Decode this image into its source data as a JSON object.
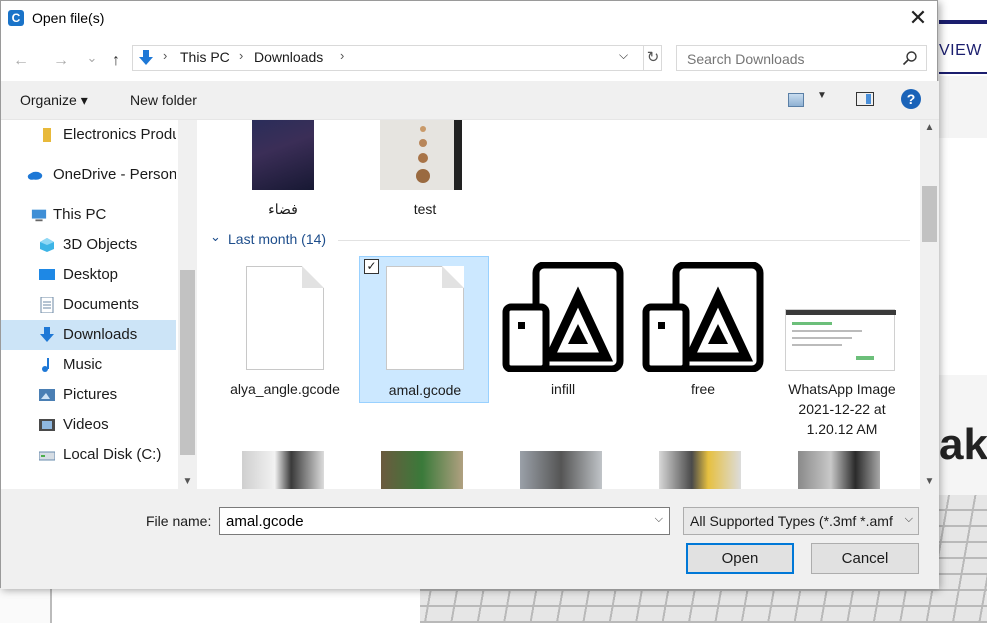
{
  "background_app": {
    "view_label": "VIEW",
    "big_text": "ake"
  },
  "dialog": {
    "title": "Open file(s)",
    "close_glyph": "✕"
  },
  "nav": {
    "back": "←",
    "forward": "→",
    "recent": "⌄",
    "up": "↑",
    "breadcrumbs": [
      "This PC",
      "Downloads"
    ],
    "sep": "›",
    "addr_dropdown": "⌵",
    "refresh": "↻",
    "search_placeholder": "Search Downloads"
  },
  "toolbar": {
    "organize": "Organize ▾",
    "new_folder": "New folder",
    "view_dropdown": "▼",
    "help": "?"
  },
  "sidebar": {
    "items": [
      {
        "label": "Electronics Produ",
        "icon": "folder-icon",
        "color": "#e8b93a"
      },
      {
        "label": "OneDrive - Persona",
        "icon": "onedrive-icon",
        "color": "#1e78d6"
      },
      {
        "label": "This PC",
        "icon": "this-pc-icon",
        "color": "#3f8fd6"
      },
      {
        "label": "3D Objects",
        "icon": "3d-objects-icon",
        "color": "#3cb4e6"
      },
      {
        "label": "Desktop",
        "icon": "desktop-icon",
        "color": "#1e88e5"
      },
      {
        "label": "Documents",
        "icon": "documents-icon",
        "color": "#6d8aa6"
      },
      {
        "label": "Downloads",
        "icon": "downloads-icon",
        "color": "#1e78d6"
      },
      {
        "label": "Music",
        "icon": "music-icon",
        "color": "#1e78d6"
      },
      {
        "label": "Pictures",
        "icon": "pictures-icon",
        "color": "#4a7fb4"
      },
      {
        "label": "Videos",
        "icon": "videos-icon",
        "color": "#4a4a4a"
      },
      {
        "label": "Local Disk (C:)",
        "icon": "local-disk-icon",
        "color": "#6a8cae"
      }
    ],
    "selected": "Downloads"
  },
  "files": {
    "top_row": [
      {
        "name": "فضاء"
      },
      {
        "name": "test"
      }
    ],
    "group_header": "Last month (14)",
    "group_toggle": "⌄",
    "items": [
      {
        "name": "alya_angle.gcode"
      },
      {
        "name": "amal.gcode",
        "checked": "✓"
      },
      {
        "name": "infill"
      },
      {
        "name": "free"
      },
      {
        "name_lines": [
          "WhatsApp Image",
          "2021-12-22 at",
          "1.20.12 AM"
        ]
      }
    ]
  },
  "bottom": {
    "file_name_label": "File name:",
    "file_name_value": "amal.gcode",
    "file_name_dd": "⌵",
    "file_type": "All Supported Types (*.3mf *.amf",
    "file_type_dd": "⌵",
    "open": "Open",
    "cancel": "Cancel"
  },
  "scroll": {
    "up": "▲",
    "down": "▼"
  }
}
